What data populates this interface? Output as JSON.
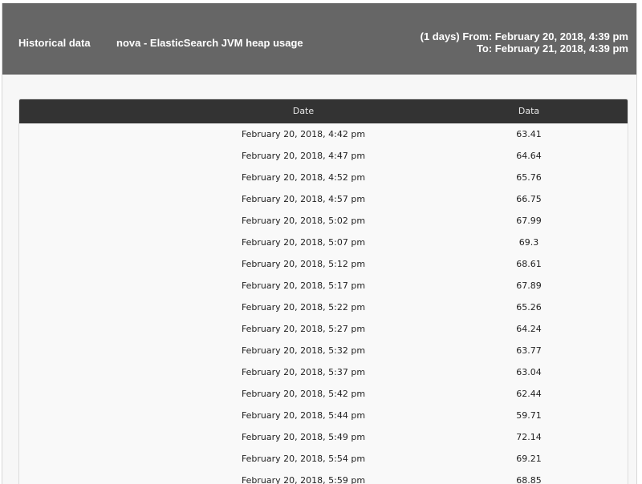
{
  "header": {
    "title": "Historical data",
    "subject": "nova - ElasticSearch JVM heap usage",
    "range_from": "(1 days) From: February 20, 2018, 4:39 pm",
    "range_to": "To: February 21, 2018, 4:39 pm"
  },
  "table": {
    "columns": [
      "Date",
      "Data"
    ],
    "rows": [
      {
        "date": "February 20, 2018, 4:42 pm",
        "value": "63.41"
      },
      {
        "date": "February 20, 2018, 4:47 pm",
        "value": "64.64"
      },
      {
        "date": "February 20, 2018, 4:52 pm",
        "value": "65.76"
      },
      {
        "date": "February 20, 2018, 4:57 pm",
        "value": "66.75"
      },
      {
        "date": "February 20, 2018, 5:02 pm",
        "value": "67.99"
      },
      {
        "date": "February 20, 2018, 5:07 pm",
        "value": "69.3"
      },
      {
        "date": "February 20, 2018, 5:12 pm",
        "value": "68.61"
      },
      {
        "date": "February 20, 2018, 5:17 pm",
        "value": "67.89"
      },
      {
        "date": "February 20, 2018, 5:22 pm",
        "value": "65.26"
      },
      {
        "date": "February 20, 2018, 5:27 pm",
        "value": "64.24"
      },
      {
        "date": "February 20, 2018, 5:32 pm",
        "value": "63.77"
      },
      {
        "date": "February 20, 2018, 5:37 pm",
        "value": "63.04"
      },
      {
        "date": "February 20, 2018, 5:42 pm",
        "value": "62.44"
      },
      {
        "date": "February 20, 2018, 5:44 pm",
        "value": "59.71"
      },
      {
        "date": "February 20, 2018, 5:49 pm",
        "value": "72.14"
      },
      {
        "date": "February 20, 2018, 5:54 pm",
        "value": "69.21"
      },
      {
        "date": "February 20, 2018, 5:59 pm",
        "value": "68.85"
      }
    ]
  }
}
